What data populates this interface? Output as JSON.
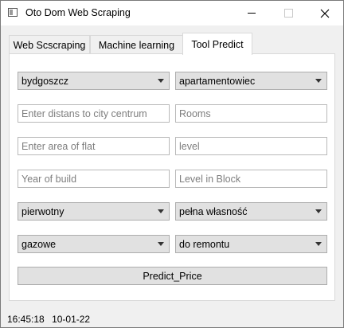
{
  "window": {
    "title": "Oto Dom Web Scraping"
  },
  "tabs": [
    {
      "label": "Web Scscraping"
    },
    {
      "label": "Machine learning"
    },
    {
      "label": "Tool Predict",
      "active": true
    }
  ],
  "form": {
    "city": "bydgoszcz",
    "building_type": "apartamentowiec",
    "distance_placeholder": "Enter distans to city centrum",
    "rooms_placeholder": "Rooms",
    "area_placeholder": "Enter area of flat",
    "level_placeholder": "level",
    "year_placeholder": "Year of build",
    "level_in_block_placeholder": "Level in Block",
    "market": "pierwotny",
    "ownership": "pełna własność",
    "heating": "gazowe",
    "condition": "do remontu",
    "predict_label": "Predict_Price"
  },
  "status": {
    "time": "16:45:18",
    "date": "10-01-22"
  }
}
